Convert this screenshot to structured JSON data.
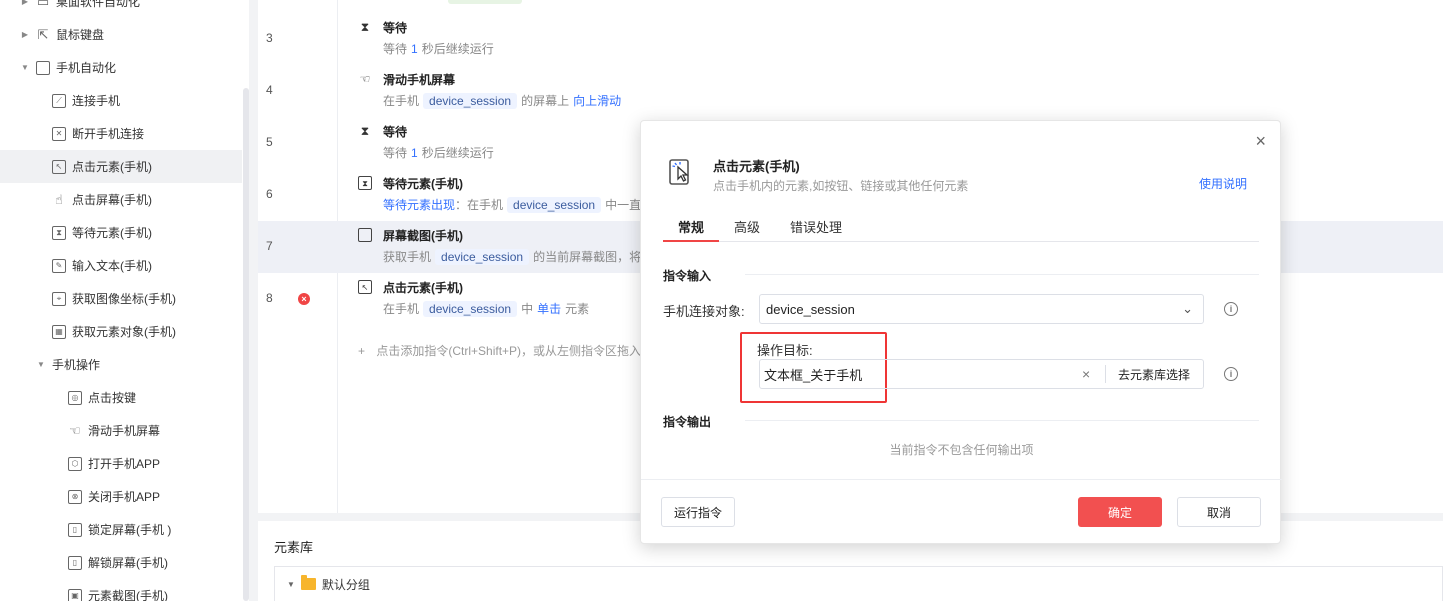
{
  "sidebar": {
    "items": [
      {
        "label": "桌面软件自动化",
        "icon": "monitor-icon",
        "caret": "▶"
      },
      {
        "label": "鼠标键盘",
        "icon": "cursor-icon",
        "caret": "▶"
      },
      {
        "label": "手机自动化",
        "icon": "phone-copy-icon",
        "caret": "▼"
      },
      {
        "label": "连接手机",
        "icon": "link-icon"
      },
      {
        "label": "断开手机连接",
        "icon": "disconnect-icon"
      },
      {
        "label": "点击元素(手机)",
        "icon": "click-element-icon",
        "selected": true
      },
      {
        "label": "点击屏幕(手机)",
        "icon": "tap-screen-icon"
      },
      {
        "label": "等待元素(手机)",
        "icon": "hourglass-box-icon"
      },
      {
        "label": "输入文本(手机)",
        "icon": "input-text-icon"
      },
      {
        "label": "获取图像坐标(手机)",
        "icon": "image-coord-icon"
      },
      {
        "label": "获取元素对象(手机)",
        "icon": "element-object-icon"
      },
      {
        "label": "手机操作",
        "icon": "",
        "caret": "▼"
      },
      {
        "label": "点击按键",
        "icon": "key-press-icon"
      },
      {
        "label": "滑动手机屏幕",
        "icon": "swipe-icon"
      },
      {
        "label": "打开手机APP",
        "icon": "open-app-icon"
      },
      {
        "label": "关闭手机APP",
        "icon": "close-app-icon"
      },
      {
        "label": "锁定屏幕(手机 )",
        "icon": "lock-screen-icon"
      },
      {
        "label": "解锁屏幕(手机)",
        "icon": "unlock-screen-icon"
      },
      {
        "label": "元素截图(手机)",
        "icon": "element-screenshot-icon"
      }
    ]
  },
  "flow": {
    "rows": [
      {
        "num": "3",
        "title": "等待",
        "icon": "hourglass-icon",
        "parts": [
          "等待",
          "1",
          "秒后继续运行"
        ]
      },
      {
        "num": "4",
        "title": "滑动手机屏幕",
        "icon": "swipe-icon",
        "parts": [
          "在手机",
          "device_session",
          "的屏幕上",
          "向上滑动"
        ]
      },
      {
        "num": "5",
        "title": "等待",
        "icon": "hourglass-icon",
        "parts": [
          "等待",
          "1",
          "秒后继续运行"
        ]
      },
      {
        "num": "6",
        "title": "等待元素(手机)",
        "icon": "hourglass-box-icon",
        "parts": [
          "等待元素出现",
          "：在手机",
          "device_session",
          "中一直"
        ]
      },
      {
        "num": "7",
        "title": "屏幕截图(手机)",
        "icon": "screenshot-icon",
        "parts": [
          "获取手机",
          "device_session",
          "的当前屏幕截图，将"
        ]
      },
      {
        "num": "8",
        "title": "点击元素(手机)",
        "icon": "click-element-icon",
        "error": "×",
        "parts": [
          "在手机",
          "device_session",
          "中",
          "单击",
          "元素"
        ]
      }
    ],
    "add_hint": "点击添加指令(Ctrl+Shift+P)，或从左侧指令区拖入",
    "add_plus": "+"
  },
  "library": {
    "title": "元素库",
    "group": "默认分组"
  },
  "dialog": {
    "title": "点击元素(手机)",
    "subtitle": "点击手机内的元素,如按钮、链接或其他任何元素",
    "help": "使用说明",
    "close": "×",
    "tabs": [
      "常规",
      "高级",
      "错误处理"
    ],
    "input_section": "指令输入",
    "conn_label": "手机连接对象:",
    "conn_value": "device_session",
    "target_label": "操作目标:",
    "target_value": "文本框_关于手机",
    "clear": "×",
    "pick_label": "去元素库选择",
    "output_section": "指令输出",
    "no_output": "当前指令不包含任何输出项",
    "run": "运行指令",
    "ok": "确定",
    "cancel": "取消",
    "info": "i"
  },
  "colors": {
    "accent": "#f25050",
    "link": "#3370ff",
    "highlight_box": "#ef3535"
  }
}
